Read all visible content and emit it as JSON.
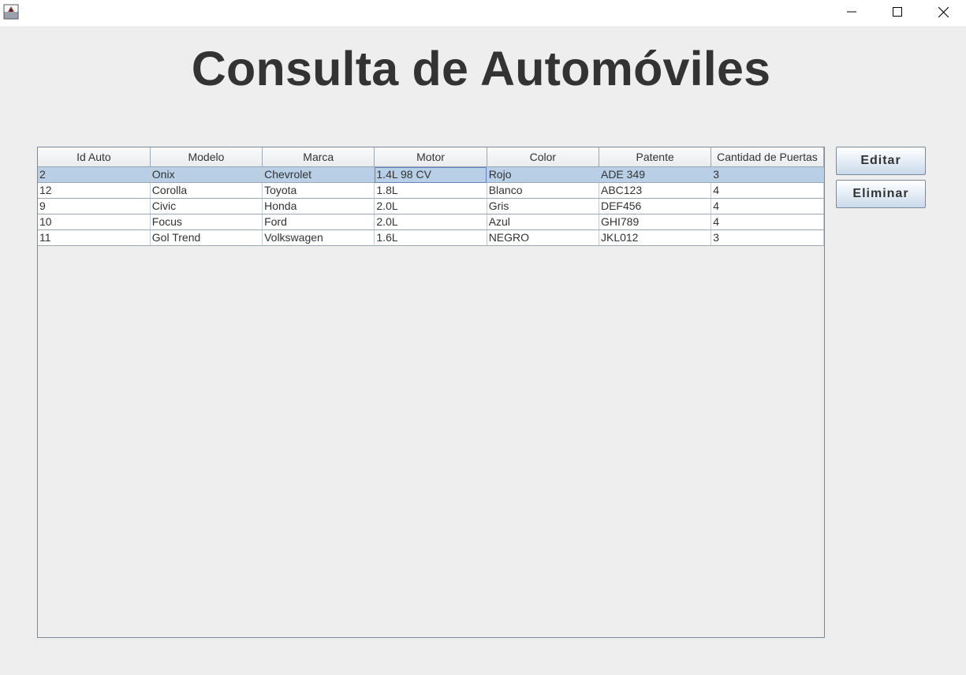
{
  "window": {
    "title": "",
    "controls": {
      "minimize_icon": "minimize-icon",
      "maximize_icon": "maximize-icon",
      "close_icon": "close-icon"
    }
  },
  "header": {
    "title": "Consulta de Automóviles"
  },
  "table": {
    "columns": [
      "Id Auto",
      "Modelo",
      "Marca",
      "Motor",
      "Color",
      "Patente",
      "Cantidad de Puertas"
    ],
    "rows": [
      [
        "2",
        "Onix",
        "Chevrolet",
        "1.4L 98 CV",
        "Rojo",
        "ADE 349",
        "3"
      ],
      [
        "12",
        "Corolla",
        "Toyota",
        "1.8L",
        "Blanco",
        "ABC123",
        "4"
      ],
      [
        "9",
        "Civic",
        "Honda",
        "2.0L",
        "Gris",
        "DEF456",
        "4"
      ],
      [
        "10",
        "Focus",
        "Ford",
        "2.0L",
        "Azul",
        "GHI789",
        "4"
      ],
      [
        "11",
        "Gol Trend",
        "Volkswagen",
        "1.6L",
        "NEGRO",
        "JKL012",
        "3"
      ]
    ],
    "selected_row": 0
  },
  "actions": {
    "edit_label": "Editar",
    "delete_label": "Eliminar"
  },
  "colors": {
    "selection": "#b8cfe5",
    "background": "#eeeeee",
    "title_text": "#333333"
  }
}
